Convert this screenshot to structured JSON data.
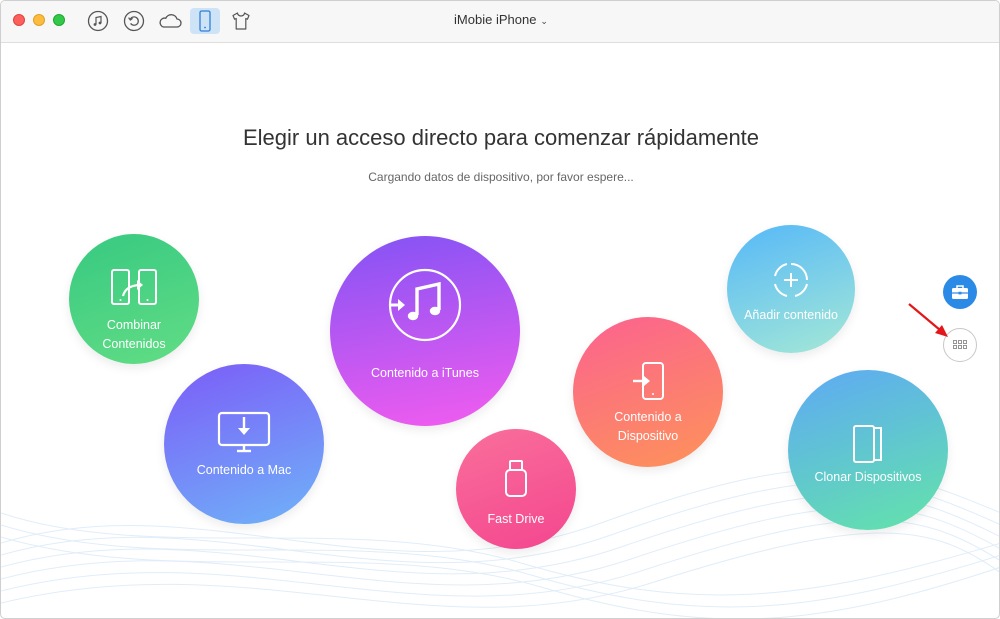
{
  "window": {
    "device_title": "iMobie iPhone",
    "caret": "⌄"
  },
  "toolbar": {
    "items": [
      {
        "name": "music-icon",
        "active": false
      },
      {
        "name": "restore-icon",
        "active": false
      },
      {
        "name": "cloud-icon",
        "active": false
      },
      {
        "name": "iphone-icon",
        "active": true
      },
      {
        "name": "tshirt-icon",
        "active": false
      }
    ]
  },
  "main": {
    "heading": "Elegir un acceso directo para comenzar rápidamente",
    "subheading": "Cargando datos de dispositivo, por favor espere..."
  },
  "shortcuts": {
    "combinar": {
      "label_1": "Combinar",
      "label_2": "Contenidos",
      "icon": "merge-devices-icon"
    },
    "mac": {
      "label": "Contenido a Mac",
      "icon": "monitor-download-icon"
    },
    "itunes": {
      "label": "Contenido a iTunes",
      "icon": "itunes-icon"
    },
    "fast_drive": {
      "label": "Fast Drive",
      "icon": "usb-drive-icon"
    },
    "dispositivo": {
      "label_1": "Contenido a",
      "label_2": "Dispositivo",
      "icon": "device-import-icon"
    },
    "anadir": {
      "label": "Añadir contenido",
      "icon": "add-circle-icon"
    },
    "clonar": {
      "label": "Clonar Dispositivos",
      "icon": "clone-device-icon"
    }
  },
  "side": {
    "toolbox_icon": "toolbox-icon",
    "grid_icon": "grid-icon"
  },
  "colors": {
    "active_tool_bg": "#cfe3f7",
    "accent_blue": "#2a8ae6",
    "arrow_red": "#e3161b"
  }
}
